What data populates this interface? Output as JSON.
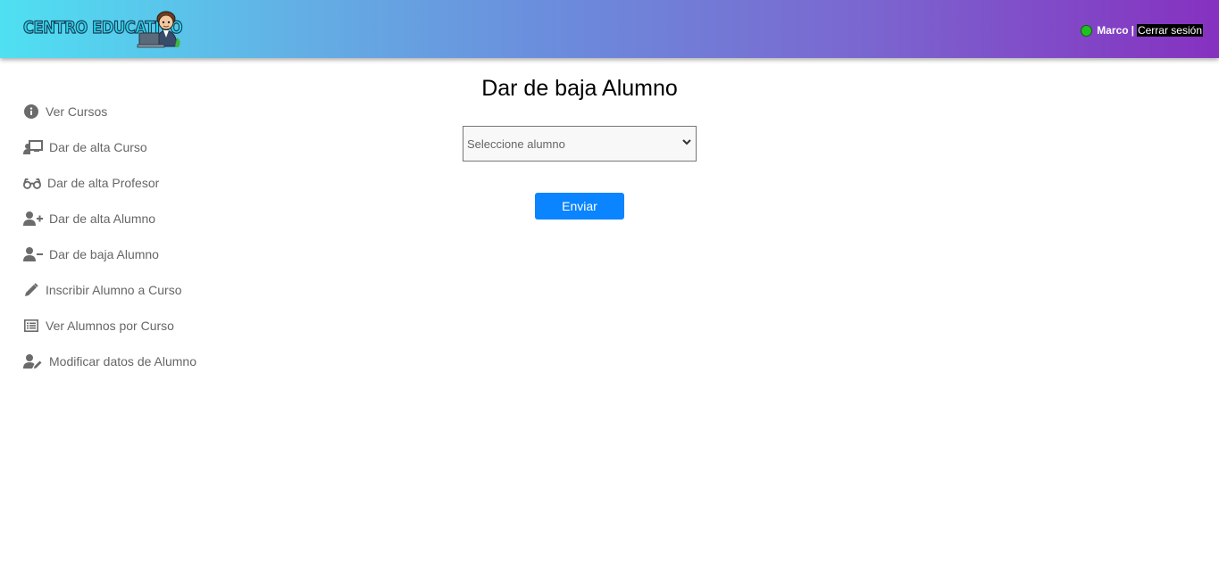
{
  "header": {
    "logo_text": "CENTRO EDUCATIVO",
    "user_name": "Marco",
    "separator": "|",
    "logout_label": "Cerrar sesión",
    "status_color": "#20c020"
  },
  "sidebar": {
    "items": [
      {
        "label": "Ver Cursos",
        "icon": "info-circle-icon"
      },
      {
        "label": "Dar de alta Curso",
        "icon": "teacher-board-icon"
      },
      {
        "label": "Dar de alta Profesor",
        "icon": "glasses-icon"
      },
      {
        "label": "Dar de alta Alumno",
        "icon": "user-plus-icon"
      },
      {
        "label": "Dar de baja Alumno",
        "icon": "user-minus-icon"
      },
      {
        "label": "Inscribir Alumno a Curso",
        "icon": "pencil-icon"
      },
      {
        "label": "Ver Alumnos por Curso",
        "icon": "list-icon"
      },
      {
        "label": "Modificar datos de Alumno",
        "icon": "user-edit-icon"
      }
    ]
  },
  "main": {
    "title": "Dar de baja Alumno",
    "select_placeholder": "Seleccione alumno",
    "submit_label": "Enviar"
  },
  "colors": {
    "accent": "#0a84ff",
    "header_gradient_start": "#4fe0f2",
    "header_gradient_end": "#8631c0",
    "sidebar_text": "#666666"
  }
}
